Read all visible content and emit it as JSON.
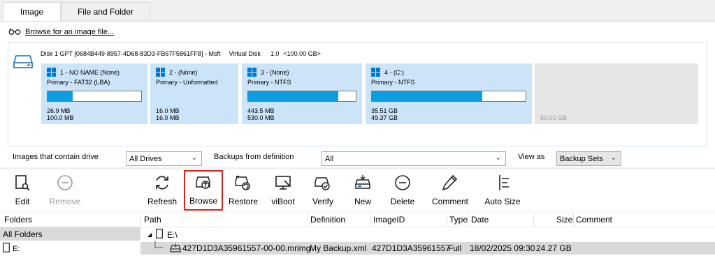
{
  "tabs": [
    {
      "label": "Image",
      "active": true
    },
    {
      "label": "File and Folder",
      "active": false
    }
  ],
  "browse_link": {
    "label": "Browse for an image file...",
    "icon": "glasses-icon"
  },
  "disk": {
    "name": "Disk 1 GPT [0684B449-8957-4D68-83D3-FB67F5861FF8] - Msft",
    "type": "Virtual Disk",
    "version": "1.0",
    "capacity": "<100.00 GB>",
    "partitions": [
      {
        "title": "1 - NO NAME (None)",
        "type": "Primary - FAT32 (LBA)",
        "used": "26.9 MB",
        "total": "100.0 MB",
        "fill": 0.27
      },
      {
        "title": "2 -  (None)",
        "type": "Primary - Unformatted",
        "used": "16.0 MB",
        "total": "16.0 MB",
        "fill": 1.0
      },
      {
        "title": "3 -  (None)",
        "type": "Primary - NTFS",
        "used": "443.5 MB",
        "total": "530.0 MB",
        "fill": 0.84
      },
      {
        "title": "4 -  (C:)",
        "type": "Primary - NTFS",
        "used": "35.51 GB",
        "total": "49.37 GB",
        "fill": 0.72
      }
    ],
    "unallocated": "50.00 GB"
  },
  "filters": {
    "images_label": "Images that contain drive",
    "images_value": "All Drives",
    "backups_label": "Backups from definition",
    "backups_value": "All",
    "view_label": "View as",
    "view_value": "Backup Sets"
  },
  "toolbar": {
    "edit": "Edit",
    "remove": "Remove",
    "refresh": "Refresh",
    "browse": "Browse",
    "restore": "Restore",
    "viboot": "viBoot",
    "verify": "Verify",
    "new": "New",
    "delete": "Delete",
    "comment": "Comment",
    "autosize": "Auto Size"
  },
  "columns": {
    "folders": "Folders",
    "path": "Path",
    "definition": "Definition",
    "imageid": "ImageID",
    "type": "Type",
    "date": "Date",
    "size": "Size",
    "comment": "Comment"
  },
  "folders": {
    "all": "All Folders",
    "drive": "E:"
  },
  "tree": {
    "root": "E:\\",
    "row": {
      "path": "427D1D3A35961557-00-00.mrimg",
      "definition": "My Backup.xml",
      "imageid": "427D1D3A35961557",
      "type": "Full",
      "date": "18/02/2025 09:30",
      "size": "24.27 GB",
      "comment": ""
    }
  },
  "colors": {
    "accent": "#0c9ee0",
    "partition_bg": "#cce4f7",
    "highlight_border": "#e02020"
  }
}
